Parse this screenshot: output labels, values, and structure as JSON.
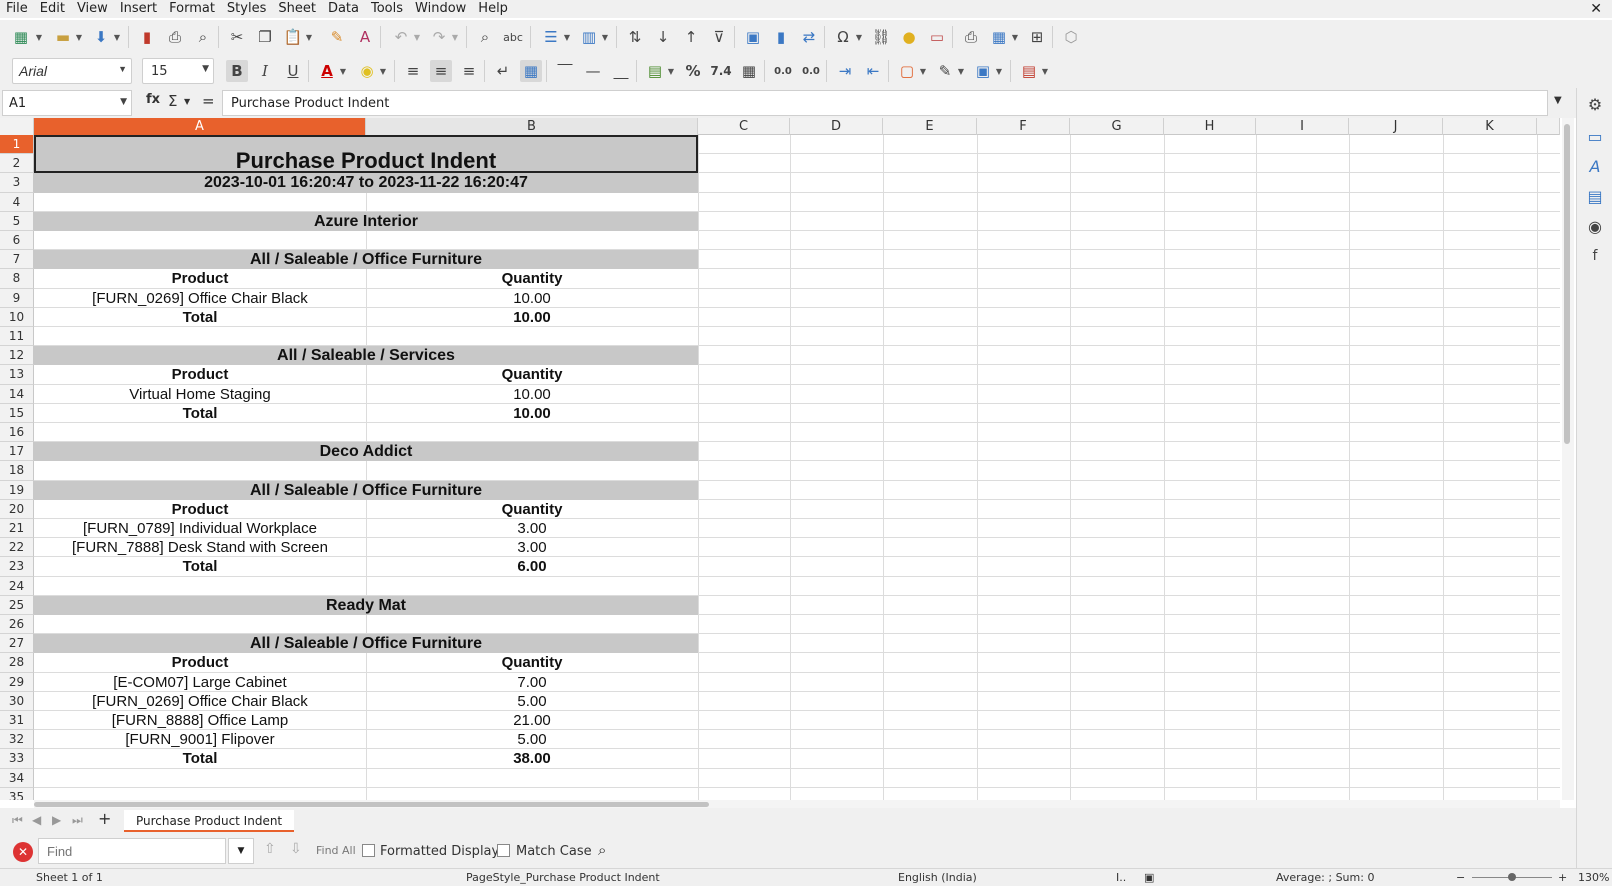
{
  "menu": [
    "File",
    "Edit",
    "View",
    "Insert",
    "Format",
    "Styles",
    "Sheet",
    "Data",
    "Tools",
    "Window",
    "Help"
  ],
  "window": {
    "close_label": "✕"
  },
  "toolbar": {
    "font_name": "Arial",
    "font_size": "15",
    "bold_label": "B",
    "italic_label": "I",
    "underline_label": "U",
    "percent_label": "%",
    "number_label": "7.4",
    "add_decimal_label": "0.0",
    "remove_decimal_label": "0.0"
  },
  "formula_bar": {
    "cell_ref": "A1",
    "fx_label": "fx",
    "sigma_label": "Σ",
    "equals_label": "=",
    "content": "Purchase Product Indent"
  },
  "grid": {
    "columns": [
      "A",
      "B",
      "C",
      "D",
      "E",
      "F",
      "G",
      "H",
      "I",
      "J",
      "K"
    ],
    "rows": [
      "1",
      "2",
      "3",
      "4",
      "5",
      "6",
      "7",
      "8",
      "9",
      "10",
      "11",
      "12",
      "13",
      "14",
      "15",
      "16",
      "17",
      "18",
      "19",
      "20",
      "21",
      "22",
      "23",
      "24",
      "25",
      "26",
      "27",
      "28",
      "29",
      "30",
      "31",
      "32",
      "33",
      "34",
      "35"
    ],
    "selected_column": "A",
    "selected_row": "1"
  },
  "report": {
    "title": "Purchase Product Indent",
    "date_range": "2023-10-01 16:20:47 to 2023-11-22 16:20:47",
    "vendors": [
      {
        "name": "Azure Interior",
        "groups": [
          {
            "category": "All / Saleable / Office Furniture",
            "product_header": "Product",
            "quantity_header": "Quantity",
            "lines": [
              {
                "product": "[FURN_0269] Office Chair Black",
                "quantity": "10.00"
              }
            ],
            "total_label": "Total",
            "total": "10.00"
          },
          {
            "category": "All / Saleable / Services",
            "product_header": "Product",
            "quantity_header": "Quantity",
            "lines": [
              {
                "product": "Virtual Home Staging",
                "quantity": "10.00"
              }
            ],
            "total_label": "Total",
            "total": "10.00"
          }
        ]
      },
      {
        "name": "Deco Addict",
        "groups": [
          {
            "category": "All / Saleable / Office Furniture",
            "product_header": "Product",
            "quantity_header": "Quantity",
            "lines": [
              {
                "product": "[FURN_0789] Individual Workplace",
                "quantity": "3.00"
              },
              {
                "product": "[FURN_7888] Desk Stand with Screen",
                "quantity": "3.00"
              }
            ],
            "total_label": "Total",
            "total": "6.00"
          }
        ]
      },
      {
        "name": "Ready Mat",
        "groups": [
          {
            "category": "All / Saleable / Office Furniture",
            "product_header": "Product",
            "quantity_header": "Quantity",
            "lines": [
              {
                "product": "[E-COM07] Large Cabinet",
                "quantity": "7.00"
              },
              {
                "product": "[FURN_0269] Office Chair Black",
                "quantity": "5.00"
              },
              {
                "product": "[FURN_8888] Office Lamp",
                "quantity": "21.00"
              },
              {
                "product": "[FURN_9001] Flipover",
                "quantity": "5.00"
              }
            ],
            "total_label": "Total",
            "total": "38.00"
          }
        ]
      }
    ]
  },
  "sheet_tabs": {
    "active": "Purchase Product Indent"
  },
  "find_bar": {
    "placeholder": "Find",
    "find_all_label": "Find All",
    "formatted_display_label": "Formatted Display",
    "match_case_label": "Match Case"
  },
  "status_bar": {
    "sheet_info": "Sheet 1 of 1",
    "page_style": "PageStyle_Purchase Product Indent",
    "language": "English (India)",
    "summary": "Average: ; Sum: 0",
    "zoom": "130%"
  },
  "colors": {
    "accent": "#e8612c",
    "band": "#c8c8c8"
  }
}
